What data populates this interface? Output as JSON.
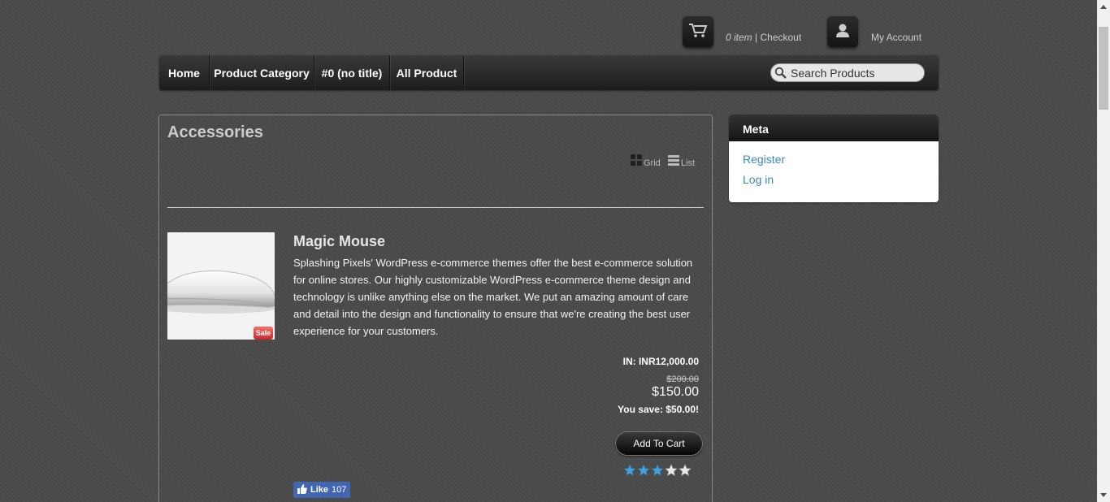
{
  "header": {
    "cart_count": "0 item",
    "cart_separator": " | ",
    "checkout_label": "Checkout",
    "account_label": "My Account"
  },
  "nav": {
    "items": [
      "Home",
      "Product Category",
      "#0 (no title)",
      "All Product"
    ],
    "search_placeholder": "Search Products"
  },
  "main": {
    "page_title": "Accessories",
    "view_grid_label": "Grid",
    "view_list_label": "List",
    "product": {
      "title": "Magic Mouse",
      "description": "Splashing Pixels' WordPress e-commerce themes offer the best e-commerce solution for online stores. Our highly customizable WordPress e-commerce theme design and technology is unlike anything else on the market. We put an amazing amount of care and detail into the design and functionality to ensure that we're creating the best user experience for your customers.",
      "sale_badge": "Sale",
      "price_in": "IN: INR12,000.00",
      "old_price": "$200.00",
      "new_price": "$150.00",
      "you_save": "You save: $50.00!",
      "add_to_cart_label": "Add To Cart",
      "rating": 3,
      "rating_max": 5,
      "like_label": "Like",
      "like_count": "107"
    }
  },
  "sidebar": {
    "title": "Meta",
    "links": [
      "Register",
      "Log in"
    ]
  },
  "colors": {
    "background": "#4a4a4a",
    "link": "#3a8ab8",
    "star_filled": "#4a9fd8",
    "star_empty": "#e8e8e8",
    "sale": "#d43a3a",
    "facebook": "#4267b2"
  }
}
